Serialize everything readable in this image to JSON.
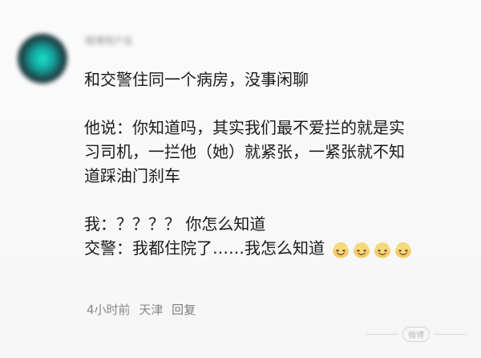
{
  "comment": {
    "username": "微博用户名",
    "lines": [
      "和交警住同一个病房，没事闲聊",
      "",
      "他说：你知道吗，其实我们最不爱拦的就是实",
      "习司机，一拦他（她）就紧张，一紧张就不知",
      "道踩油门刹车",
      "",
      "我：？？？？ 你怎么知道",
      "交警：我都住院了……我怎么知道"
    ],
    "meta": {
      "time": "4小时前",
      "location": "天津",
      "reply": "回复"
    }
  },
  "emoji": {
    "name": "laughing-face-icon",
    "count": 4
  },
  "watermark": {
    "text": "微博"
  }
}
